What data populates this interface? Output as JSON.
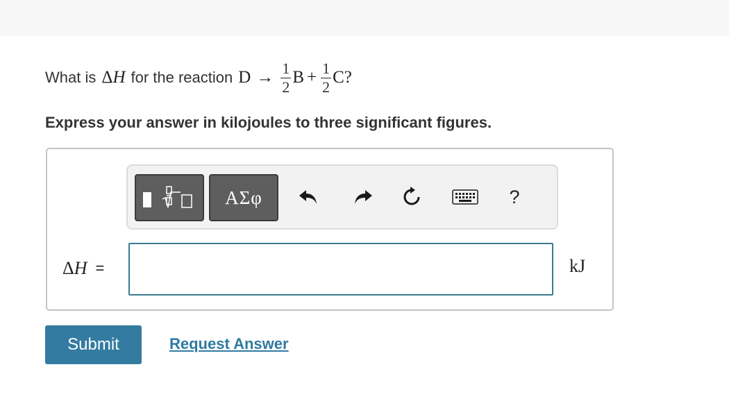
{
  "question": {
    "prefix": "What is",
    "symbol_delta": "Δ",
    "symbol_h": "H",
    "middle": "for the reaction",
    "reactant": "D",
    "arrow": "→",
    "coef1_num": "1",
    "coef1_den": "2",
    "product1": "B",
    "plus": "+",
    "coef2_num": "1",
    "coef2_den": "2",
    "product2": "C",
    "end": "?"
  },
  "instruction": "Express your answer in kilojoules to three significant figures.",
  "toolbar": {
    "greek_label": "ΑΣφ",
    "help_label": "?",
    "icons": [
      "templates-icon",
      "undo-icon",
      "redo-icon",
      "reset-icon",
      "keyboard-icon"
    ]
  },
  "answer": {
    "label_delta": "Δ",
    "label_h": "H",
    "equals": "=",
    "value": "",
    "units": "kJ"
  },
  "actions": {
    "submit_label": "Submit",
    "request_label": "Request Answer"
  },
  "colors": {
    "submit_bg": "#347ba1",
    "link": "#2f7aa1",
    "input_border": "#3a7a92",
    "toolbar_button": "#5e5e5e"
  }
}
